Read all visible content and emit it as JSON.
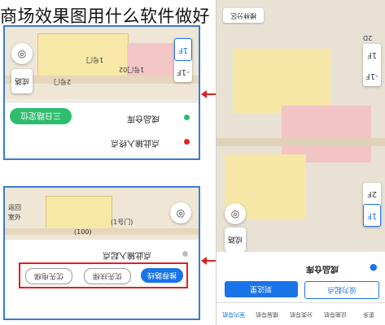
{
  "caption": "商场效果图用什么软件做好",
  "colors": {
    "accent_blue": "#1a73e8",
    "green": "#2ebd6e",
    "red": "#e02020",
    "map_bg": "#efe6d6"
  },
  "panel1": {
    "side_btn_label": "成路",
    "floors": [
      "1F",
      "-1F"
    ],
    "green_button": "三日路定位",
    "map_labels": [
      "1号门",
      "1号门02",
      "2号门"
    ],
    "rows": [
      {
        "text": "成品仓库",
        "dot": "green"
      },
      {
        "text": "点此输入终点",
        "dot": "red"
      }
    ]
  },
  "panel2": {
    "map_labels": [
      "返回",
      "室外",
      "(1号门)",
      "(100)"
    ],
    "rows": [
      {
        "text": "点此输入起点"
      }
    ],
    "route_buttons": [
      "推荐路线",
      "优先扶梯",
      "优先电梯"
    ]
  },
  "phone": {
    "search_label": "楼林分区",
    "view_toggle": "2D",
    "floors_top": [
      "1F",
      "-1F"
    ],
    "floors_mid": [
      "2F",
      "1F"
    ],
    "side_btn_label": "成路",
    "destination": "成品仓库",
    "set_start": "设为起点",
    "set_dest": "到这里",
    "tabs": [
      "室内导航",
      "楼层导航",
      "分类导航",
      "设施导航",
      "更多"
    ]
  }
}
